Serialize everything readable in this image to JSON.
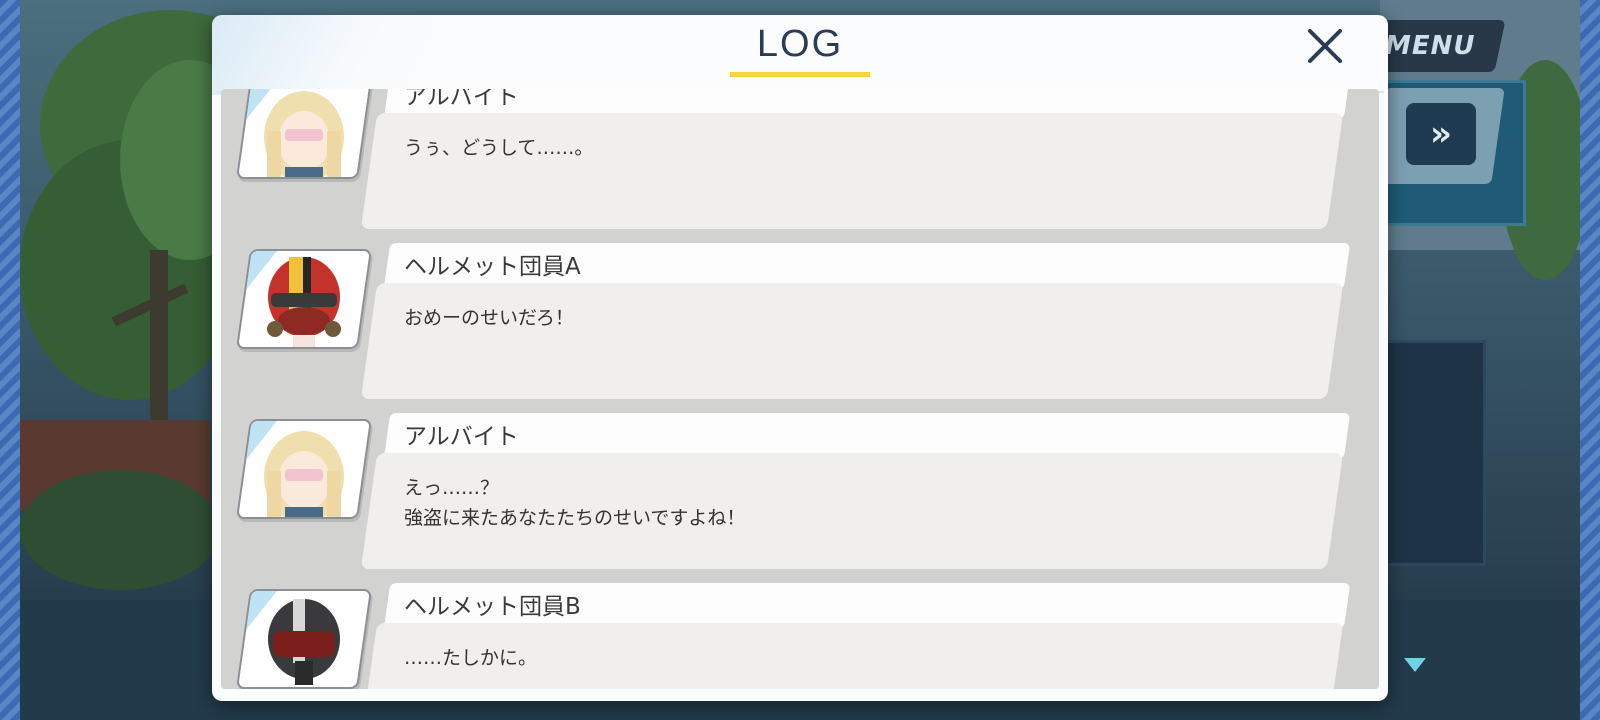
{
  "log": {
    "title": "LOG",
    "entries": [
      {
        "speaker": "アルバイト",
        "message": "うぅ、どうして……。",
        "portrait": "blonde-girl-portrait"
      },
      {
        "speaker": "ヘルメット団員A",
        "message": "おめーのせいだろ！",
        "portrait": "red-helmet-portrait"
      },
      {
        "speaker": "アルバイト",
        "message": "えっ……？\n強盗に来たあなたたちのせいですよね！",
        "portrait": "blonde-girl-portrait"
      },
      {
        "speaker": "ヘルメット団員B",
        "message": "……たしかに。",
        "portrait": "black-helmet-portrait"
      }
    ]
  },
  "hud": {
    "menu_label": "MENU"
  },
  "icons": {
    "close": "close-icon",
    "fast_forward": "fast-forward-icon",
    "next": "next-arrow-icon"
  },
  "colors": {
    "title_underline": "#f4d638",
    "title_text": "#2b3d55",
    "next_arrow": "#6cd4e3"
  }
}
